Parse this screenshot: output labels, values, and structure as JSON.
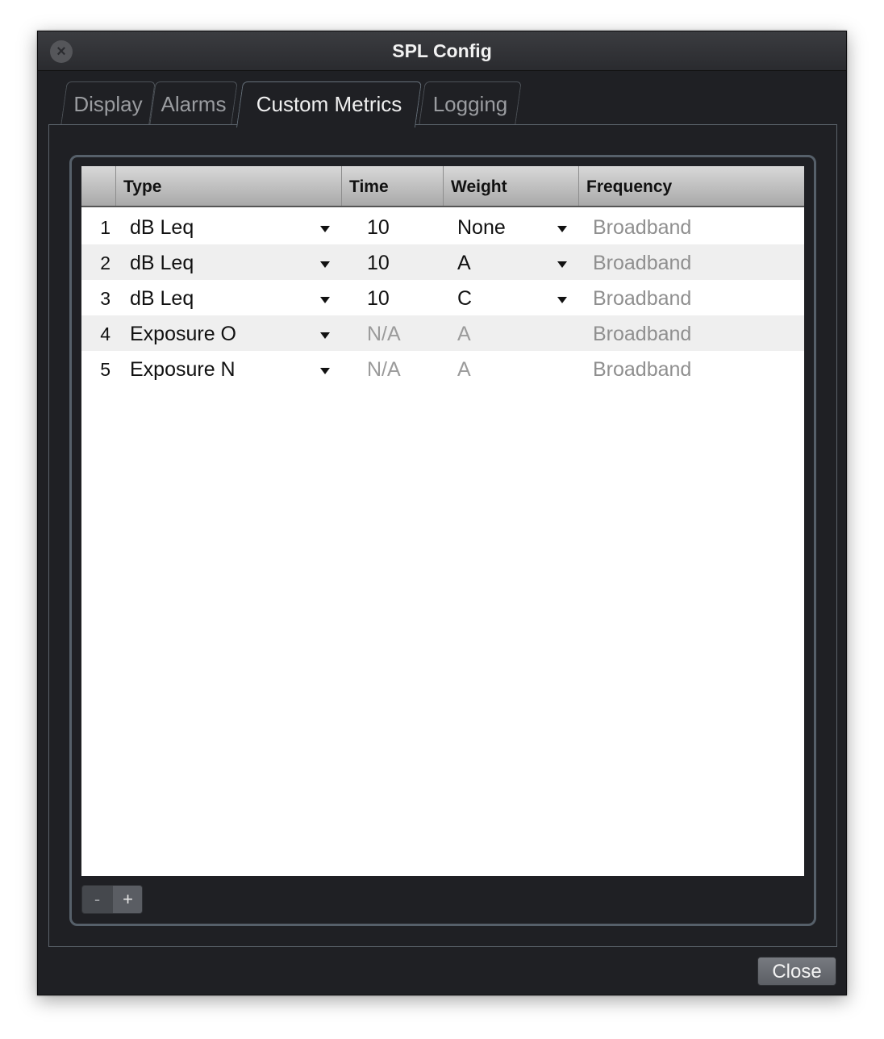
{
  "window": {
    "title": "SPL Config"
  },
  "tabs": [
    {
      "label": "Display",
      "active": false
    },
    {
      "label": "Alarms",
      "active": false
    },
    {
      "label": "Custom Metrics",
      "active": true
    },
    {
      "label": "Logging",
      "active": false
    }
  ],
  "table": {
    "columns": [
      "",
      "Type",
      "Time",
      "Weight",
      "Frequency"
    ],
    "rows": [
      {
        "num": "1",
        "type": "dB Leq",
        "time": "10",
        "weight": "None",
        "weight_dropdown": true,
        "frequency": "Broadband",
        "enabled": true
      },
      {
        "num": "2",
        "type": "dB Leq",
        "time": "10",
        "weight": "A",
        "weight_dropdown": true,
        "frequency": "Broadband",
        "enabled": true
      },
      {
        "num": "3",
        "type": "dB Leq",
        "time": "10",
        "weight": "C",
        "weight_dropdown": true,
        "frequency": "Broadband",
        "enabled": true
      },
      {
        "num": "4",
        "type": "Exposure O",
        "time": "N/A",
        "weight": "A",
        "weight_dropdown": false,
        "frequency": "Broadband",
        "enabled": false
      },
      {
        "num": "5",
        "type": "Exposure N",
        "time": "N/A",
        "weight": "A",
        "weight_dropdown": false,
        "frequency": "Broadband",
        "enabled": false
      }
    ]
  },
  "controls": {
    "remove_label": "-",
    "add_label": "+",
    "close_label": "Close"
  },
  "icons": {
    "window_close": "close-icon",
    "dropdown": "chevron-down-icon"
  },
  "colors": {
    "window_bg": "#1f2024",
    "panel_border": "#5b636b",
    "alt_row": "#efefef",
    "disabled_text": "#9b9b9b"
  }
}
